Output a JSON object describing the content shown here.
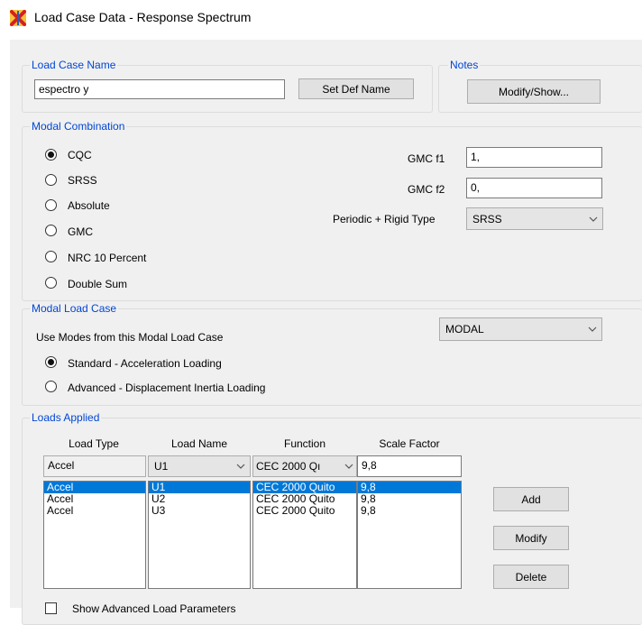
{
  "window": {
    "title": "Load Case Data - Response Spectrum",
    "app_icon": "x-logo-icon"
  },
  "load_case_name": {
    "group_title": "Load Case Name",
    "value": "espectro y",
    "set_def_label": "Set Def Name"
  },
  "notes": {
    "group_title": "Notes",
    "button_label": "Modify/Show..."
  },
  "modal_combination": {
    "group_title": "Modal Combination",
    "options": [
      "CQC",
      "SRSS",
      "Absolute",
      "GMC",
      "NRC 10 Percent",
      "Double Sum"
    ],
    "selected": "CQC",
    "gmc_f1_label": "GMC  f1",
    "gmc_f1_value": "1,",
    "gmc_f2_label": "GMC  f2",
    "gmc_f2_value": "0,",
    "periodic_label": "Periodic + Rigid Type",
    "periodic_value": "SRSS"
  },
  "modal_load_case": {
    "group_title": "Modal Load Case",
    "use_modes_label": "Use Modes from this Modal Load Case",
    "modal_value": "MODAL",
    "options": [
      "Standard - Acceleration Loading",
      "Advanced - Displacement Inertia Loading"
    ],
    "selected": "Standard - Acceleration Loading"
  },
  "loads_applied": {
    "group_title": "Loads Applied",
    "columns": [
      "Load Type",
      "Load Name",
      "Function",
      "Scale Factor"
    ],
    "editor": {
      "load_type": "Accel",
      "load_name": "U1",
      "function": "CEC 2000 Qı",
      "scale_factor": "9,8"
    },
    "rows": [
      {
        "load_type": "Accel",
        "load_name": "U1",
        "function": "CEC 2000 Quito",
        "scale_factor": "9,8"
      },
      {
        "load_type": "Accel",
        "load_name": "U2",
        "function": "CEC 2000 Quito",
        "scale_factor": "9,8"
      },
      {
        "load_type": "Accel",
        "load_name": "U3",
        "function": "CEC 2000 Quito",
        "scale_factor": "9,8"
      }
    ],
    "selected_row": 0,
    "buttons": {
      "add": "Add",
      "modify": "Modify",
      "delete": "Delete"
    },
    "advanced_checkbox_label": "Show Advanced Load Parameters"
  },
  "colors": {
    "accent_blue": "#0046d5",
    "selection": "#0078d7",
    "dialog_bg": "#f0f0f0"
  }
}
